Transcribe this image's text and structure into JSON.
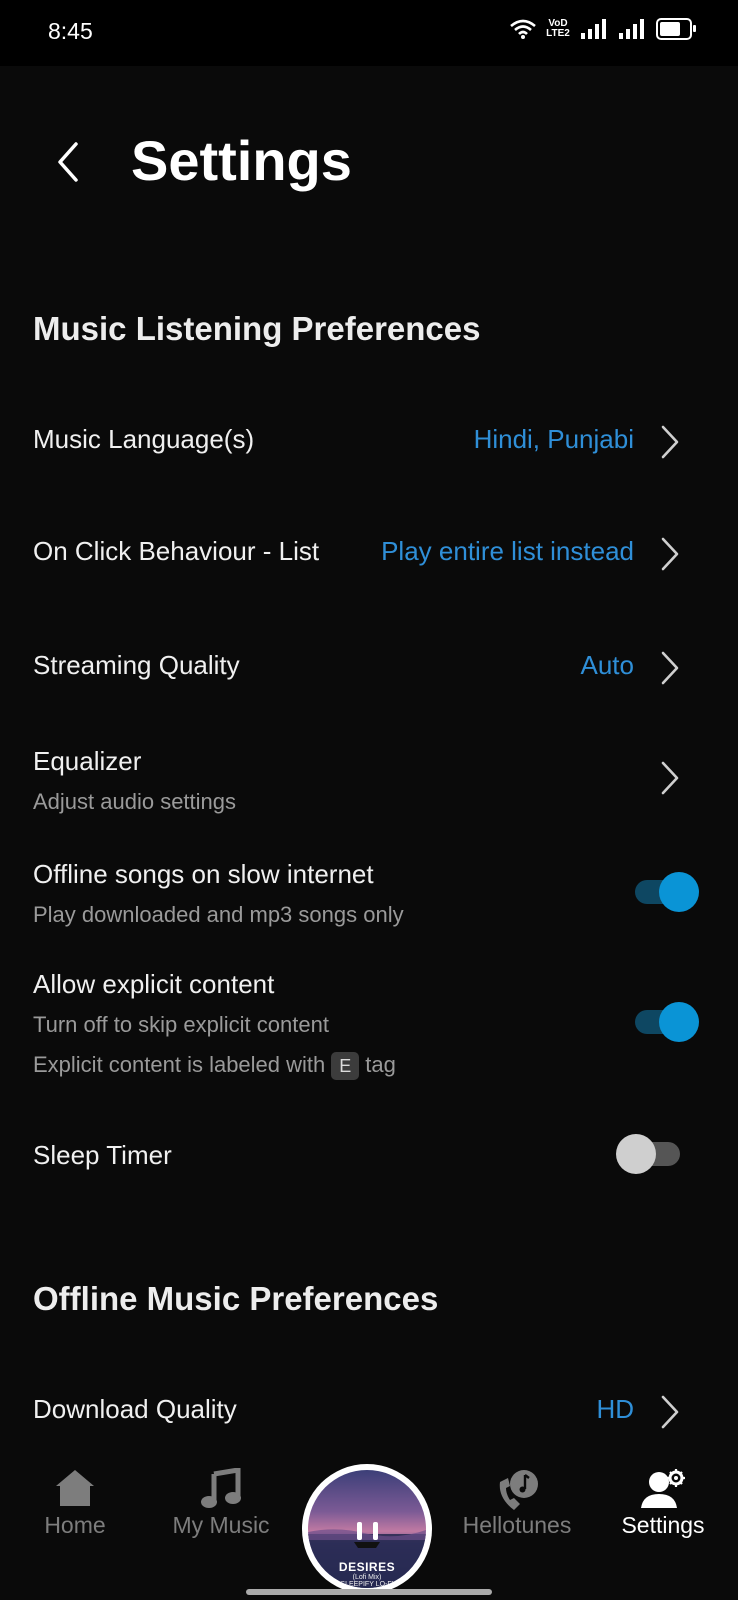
{
  "status_bar": {
    "time": "8:45",
    "network_label": "VoD LTE2"
  },
  "header": {
    "title": "Settings"
  },
  "sections": {
    "music_listening": {
      "title": "Music Listening Preferences",
      "music_language": {
        "label": "Music Language(s)",
        "value": "Hindi, Punjabi"
      },
      "on_click": {
        "label": "On Click Behaviour - List",
        "value": "Play entire list instead"
      },
      "streaming_quality": {
        "label": "Streaming Quality",
        "value": "Auto"
      },
      "equalizer": {
        "label": "Equalizer",
        "subtitle": "Adjust audio settings"
      },
      "offline_slow": {
        "label": "Offline songs on slow internet",
        "subtitle": "Play downloaded and mp3 songs only",
        "enabled": true
      },
      "explicit": {
        "label": "Allow explicit content",
        "subtitle": "Turn off to skip explicit content",
        "note_before": "Explicit content is labeled with",
        "tag": "E",
        "note_after": "tag",
        "enabled": true
      },
      "sleep_timer": {
        "label": "Sleep Timer",
        "enabled": false
      }
    },
    "offline_music": {
      "title": "Offline Music Preferences",
      "download_quality": {
        "label": "Download Quality",
        "value": "HD"
      }
    }
  },
  "now_playing": {
    "title": "DESIRES",
    "subtitle": "(Lofi Mix)",
    "artist": "SLEEPIFY LO-FI"
  },
  "bottom_nav": {
    "home": "Home",
    "my_music": "My Music",
    "hellotunes": "Hellotunes",
    "settings": "Settings",
    "active": "settings"
  },
  "colors": {
    "accent": "#2f8fd8",
    "toggle_on": "#0a94d6",
    "background": "#0a0a0a"
  }
}
